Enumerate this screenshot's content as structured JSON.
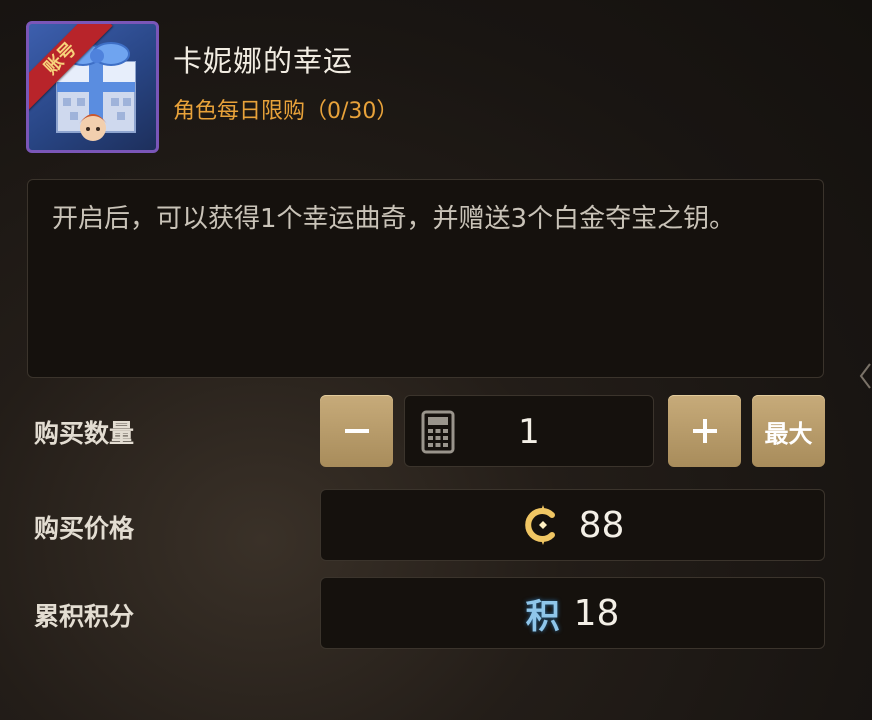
{
  "item": {
    "badge": "账号",
    "title": "卡妮娜的幸运",
    "limit": "角色每日限购（0/30）",
    "description": "开启后，可以获得1个幸运曲奇，并赠送3个白金夺宝之钥。"
  },
  "quantity": {
    "label": "购买数量",
    "value": "1",
    "max_label": "最大"
  },
  "price": {
    "label": "购买价格",
    "value": "88"
  },
  "points": {
    "label": "累积积分",
    "icon_glyph": "积",
    "value": "18"
  },
  "colors": {
    "accent_gold": "#b89b69",
    "limit_orange": "#e8a23a",
    "points_blue": "#8fc6ea",
    "icon_border_purple": "#7a56b8"
  }
}
